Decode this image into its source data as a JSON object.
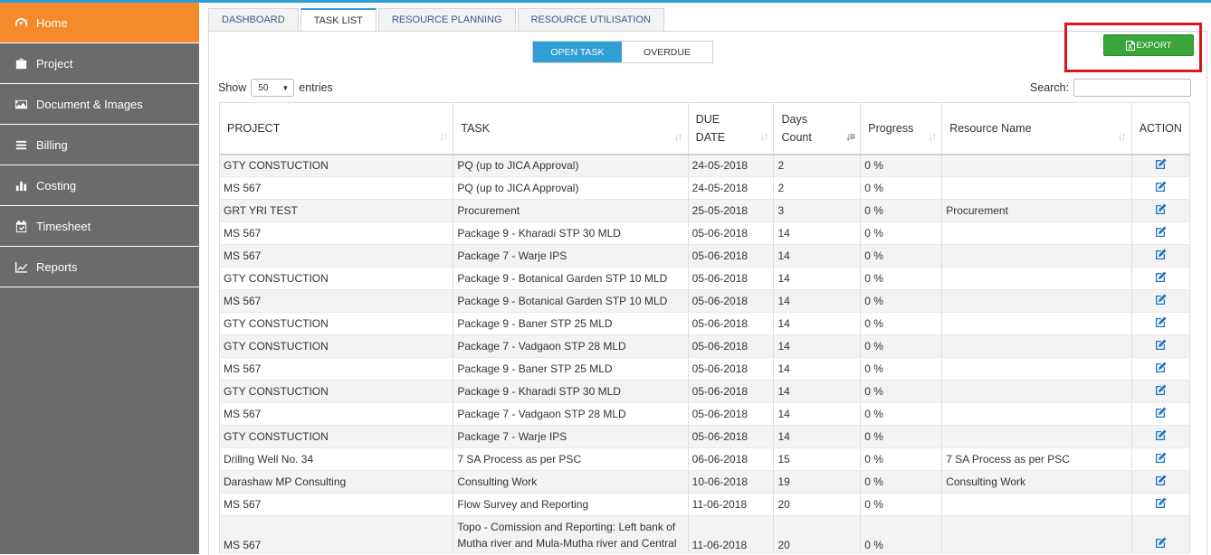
{
  "sidebar": {
    "items": [
      {
        "label": "Home",
        "icon": "dashboard-icon",
        "active": true
      },
      {
        "label": "Project",
        "icon": "briefcase-icon"
      },
      {
        "label": "Document & Images",
        "icon": "image-icon"
      },
      {
        "label": "Billing",
        "icon": "list-icon"
      },
      {
        "label": "Costing",
        "icon": "bar-chart-icon"
      },
      {
        "label": "Timesheet",
        "icon": "calendar-check-icon"
      },
      {
        "label": "Reports",
        "icon": "line-chart-icon"
      }
    ]
  },
  "tabs": [
    "DASHBOARD",
    "TASK LIST",
    "RESOURCE PLANNING",
    "RESOURCE UTILISATION"
  ],
  "active_tab": "TASK LIST",
  "toggle": {
    "open": "OPEN TASK",
    "overdue": "OVERDUE",
    "selected": "OPEN TASK"
  },
  "export_label": "EXPORT",
  "length": {
    "show": "Show",
    "value": "50",
    "entries": "entries"
  },
  "search_label": "Search:",
  "table": {
    "headers": {
      "project": "PROJECT",
      "task": "TASK",
      "due1": "DUE",
      "due2": "DATE",
      "days1": "Days",
      "days2": "Count",
      "progress": "Progress",
      "resource": "Resource Name",
      "action": "ACTION"
    },
    "rows": [
      {
        "project": "GTY CONSTUCTION",
        "task": "PQ (up to JICA Approval)",
        "due": "24-05-2018",
        "days": "2",
        "progress": "0 %",
        "resource": ""
      },
      {
        "project": "MS 567",
        "task": "PQ (up to JICA Approval)",
        "due": "24-05-2018",
        "days": "2",
        "progress": "0 %",
        "resource": ""
      },
      {
        "project": "GRT YRI TEST",
        "task": "Procurement",
        "due": "25-05-2018",
        "days": "3",
        "progress": "0 %",
        "resource": "Procurement"
      },
      {
        "project": "MS 567",
        "task": "Package 9 - Kharadi STP 30 MLD",
        "due": "05-06-2018",
        "days": "14",
        "progress": "0 %",
        "resource": ""
      },
      {
        "project": "MS 567",
        "task": "Package 7 - Warje IPS",
        "due": "05-06-2018",
        "days": "14",
        "progress": "0 %",
        "resource": ""
      },
      {
        "project": "GTY CONSTUCTION",
        "task": "Package 9 - Botanical Garden STP 10 MLD",
        "due": "05-06-2018",
        "days": "14",
        "progress": "0 %",
        "resource": ""
      },
      {
        "project": "MS 567",
        "task": "Package 9 - Botanical Garden STP 10 MLD",
        "due": "05-06-2018",
        "days": "14",
        "progress": "0 %",
        "resource": ""
      },
      {
        "project": "GTY CONSTUCTION",
        "task": "Package 9 - Baner STP 25 MLD",
        "due": "05-06-2018",
        "days": "14",
        "progress": "0 %",
        "resource": ""
      },
      {
        "project": "GTY CONSTUCTION",
        "task": "Package 7 - Vadgaon STP 28 MLD",
        "due": "05-06-2018",
        "days": "14",
        "progress": "0 %",
        "resource": ""
      },
      {
        "project": "MS 567",
        "task": "Package 9 - Baner STP 25 MLD",
        "due": "05-06-2018",
        "days": "14",
        "progress": "0 %",
        "resource": ""
      },
      {
        "project": "GTY CONSTUCTION",
        "task": "Package 9 - Kharadi STP 30 MLD",
        "due": "05-06-2018",
        "days": "14",
        "progress": "0 %",
        "resource": ""
      },
      {
        "project": "MS 567",
        "task": "Package 7 - Vadgaon STP 28 MLD",
        "due": "05-06-2018",
        "days": "14",
        "progress": "0 %",
        "resource": ""
      },
      {
        "project": "GTY CONSTUCTION",
        "task": "Package 7 - Warje IPS",
        "due": "05-06-2018",
        "days": "14",
        "progress": "0 %",
        "resource": ""
      },
      {
        "project": "Drillng Well No. 34",
        "task": "7 SA Process as per PSC",
        "due": "06-06-2018",
        "days": "15",
        "progress": "0 %",
        "resource": "7 SA Process as per PSC"
      },
      {
        "project": "Darashaw MP Consulting",
        "task": "Consulting Work",
        "due": "10-06-2018",
        "days": "19",
        "progress": "0 %",
        "resource": "Consulting Work"
      },
      {
        "project": "MS 567",
        "task": "Flow Survey and Reporting",
        "due": "11-06-2018",
        "days": "20",
        "progress": "0 %",
        "resource": ""
      },
      {
        "project": "MS 567",
        "task": "Topo - Comission and Reporting: Left bank of Mutha river and Mula-Mutha river and Central",
        "due": "11-06-2018",
        "days": "20",
        "progress": "0 %",
        "resource": ""
      }
    ]
  }
}
